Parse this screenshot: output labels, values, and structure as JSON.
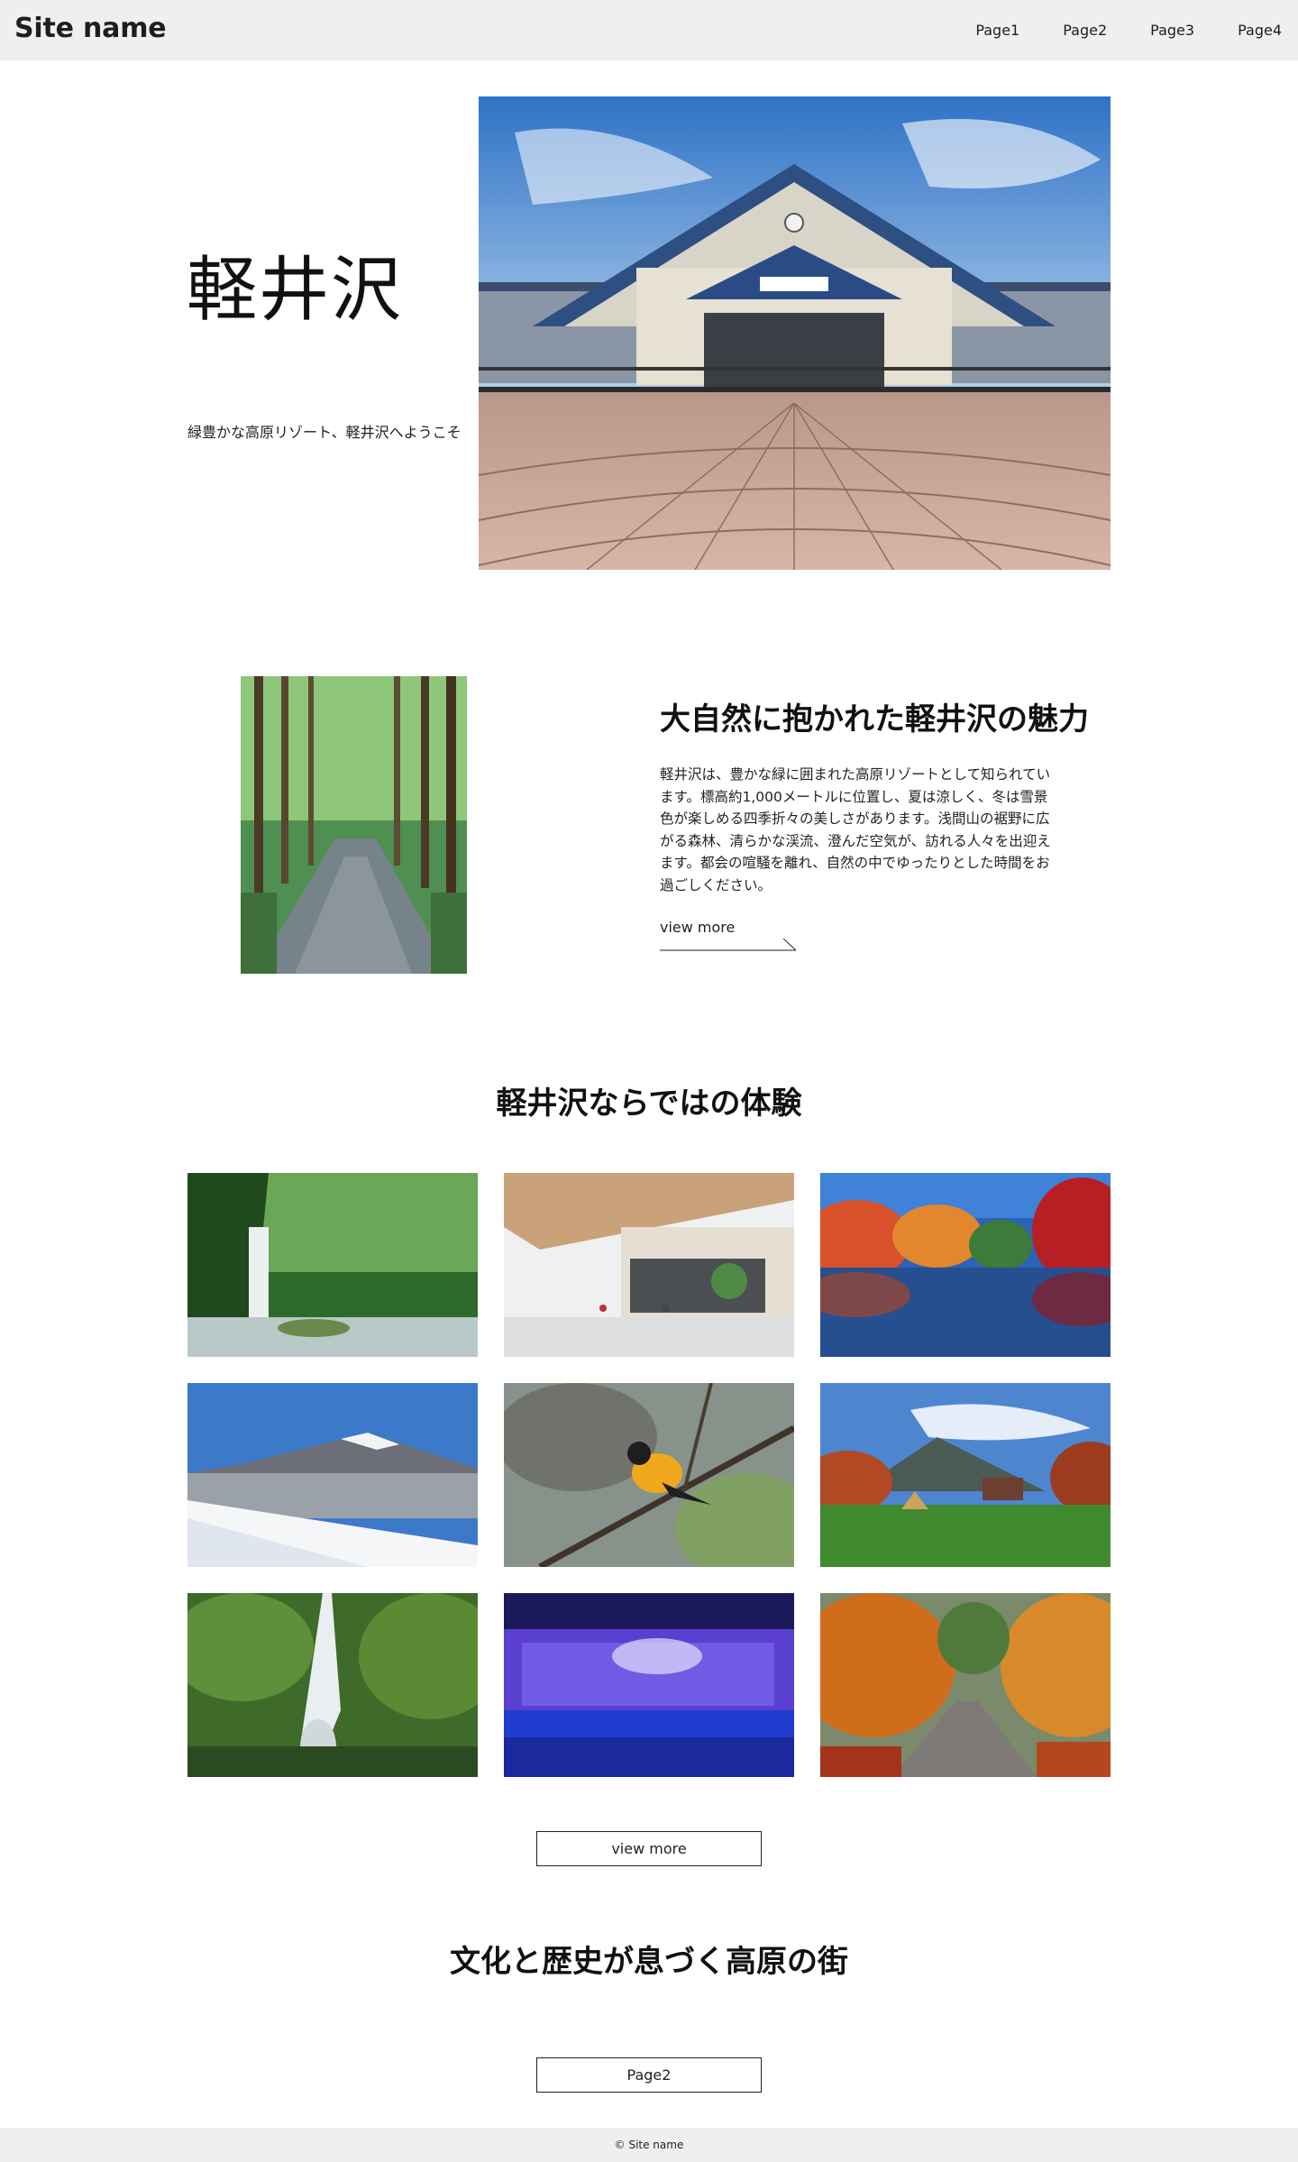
{
  "header": {
    "site_name": "Site name",
    "nav": [
      "Page1",
      "Page2",
      "Page3",
      "Page4"
    ]
  },
  "hero": {
    "title": "軽井沢",
    "subtitle": "緑豊かな高原リゾート、軽井沢へようこそ",
    "image_icon": "station-building-photo"
  },
  "about": {
    "heading": "大自然に抱かれた軽井沢の魅力",
    "body": "軽井沢は、豊かな緑に囲まれた高原リゾートとして知られています。標高約1,000メートルに位置し、夏は涼しく、冬は雪景色が楽しめる四季折々の美しさがあります。浅間山の裾野に広がる森林、清らかな渓流、澄んだ空気が、訪れる人々を出迎えます。都会の喧騒を離れ、自然の中でゆったりとした時間をお過ごしください。",
    "link_label": "view more",
    "image_icon": "forest-path-photo"
  },
  "experiences": {
    "heading": "軽井沢ならではの体験",
    "items": [
      {
        "icon": "waterfall-forest-photo"
      },
      {
        "icon": "shopping-mall-photo"
      },
      {
        "icon": "autumn-pond-photo"
      },
      {
        "icon": "snowy-mountain-photo"
      },
      {
        "icon": "bird-on-branch-photo"
      },
      {
        "icon": "meadow-camp-photo"
      },
      {
        "icon": "tall-waterfall-photo"
      },
      {
        "icon": "illuminated-falls-photo"
      },
      {
        "icon": "autumn-road-photo"
      }
    ],
    "button_label": "view more"
  },
  "culture": {
    "heading": "文化と歴史が息づく高原の街",
    "button_label": "Page2"
  },
  "footer": {
    "copyright": "© Site name"
  },
  "colors": {
    "header_bg": "#efefef",
    "footer_bg": "#efefef",
    "text": "#111111"
  }
}
